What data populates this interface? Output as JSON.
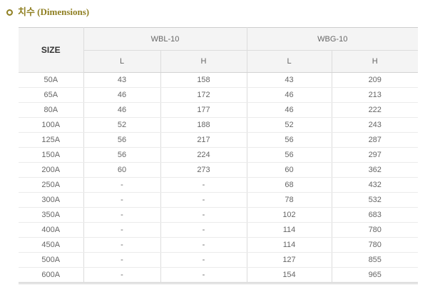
{
  "section": {
    "title": "치수 (Dimensions)",
    "bullet_icon": "circle-bullet-icon"
  },
  "colors": {
    "accent": "#8f7f22",
    "header_background": "#f4f4f4",
    "text": "#666666",
    "heading_text": "#333333"
  },
  "table": {
    "size_header": "SIZE",
    "groups": [
      {
        "name": "WBL-10",
        "columns": [
          "L",
          "H"
        ]
      },
      {
        "name": "WBG-10",
        "columns": [
          "L",
          "H"
        ]
      }
    ],
    "rows": [
      {
        "size": "50A",
        "wbl_l": "43",
        "wbl_h": "158",
        "wbg_l": "43",
        "wbg_h": "209"
      },
      {
        "size": "65A",
        "wbl_l": "46",
        "wbl_h": "172",
        "wbg_l": "46",
        "wbg_h": "213"
      },
      {
        "size": "80A",
        "wbl_l": "46",
        "wbl_h": "177",
        "wbg_l": "46",
        "wbg_h": "222"
      },
      {
        "size": "100A",
        "wbl_l": "52",
        "wbl_h": "188",
        "wbg_l": "52",
        "wbg_h": "243"
      },
      {
        "size": "125A",
        "wbl_l": "56",
        "wbl_h": "217",
        "wbg_l": "56",
        "wbg_h": "287"
      },
      {
        "size": "150A",
        "wbl_l": "56",
        "wbl_h": "224",
        "wbg_l": "56",
        "wbg_h": "297"
      },
      {
        "size": "200A",
        "wbl_l": "60",
        "wbl_h": "273",
        "wbg_l": "60",
        "wbg_h": "362"
      },
      {
        "size": "250A",
        "wbl_l": "-",
        "wbl_h": "-",
        "wbg_l": "68",
        "wbg_h": "432"
      },
      {
        "size": "300A",
        "wbl_l": "-",
        "wbl_h": "-",
        "wbg_l": "78",
        "wbg_h": "532"
      },
      {
        "size": "350A",
        "wbl_l": "-",
        "wbl_h": "-",
        "wbg_l": "102",
        "wbg_h": "683"
      },
      {
        "size": "400A",
        "wbl_l": "-",
        "wbl_h": "-",
        "wbg_l": "114",
        "wbg_h": "780"
      },
      {
        "size": "450A",
        "wbl_l": "-",
        "wbl_h": "-",
        "wbg_l": "114",
        "wbg_h": "780"
      },
      {
        "size": "500A",
        "wbl_l": "-",
        "wbl_h": "-",
        "wbg_l": "127",
        "wbg_h": "855"
      },
      {
        "size": "600A",
        "wbl_l": "-",
        "wbl_h": "-",
        "wbg_l": "154",
        "wbg_h": "965"
      }
    ]
  }
}
